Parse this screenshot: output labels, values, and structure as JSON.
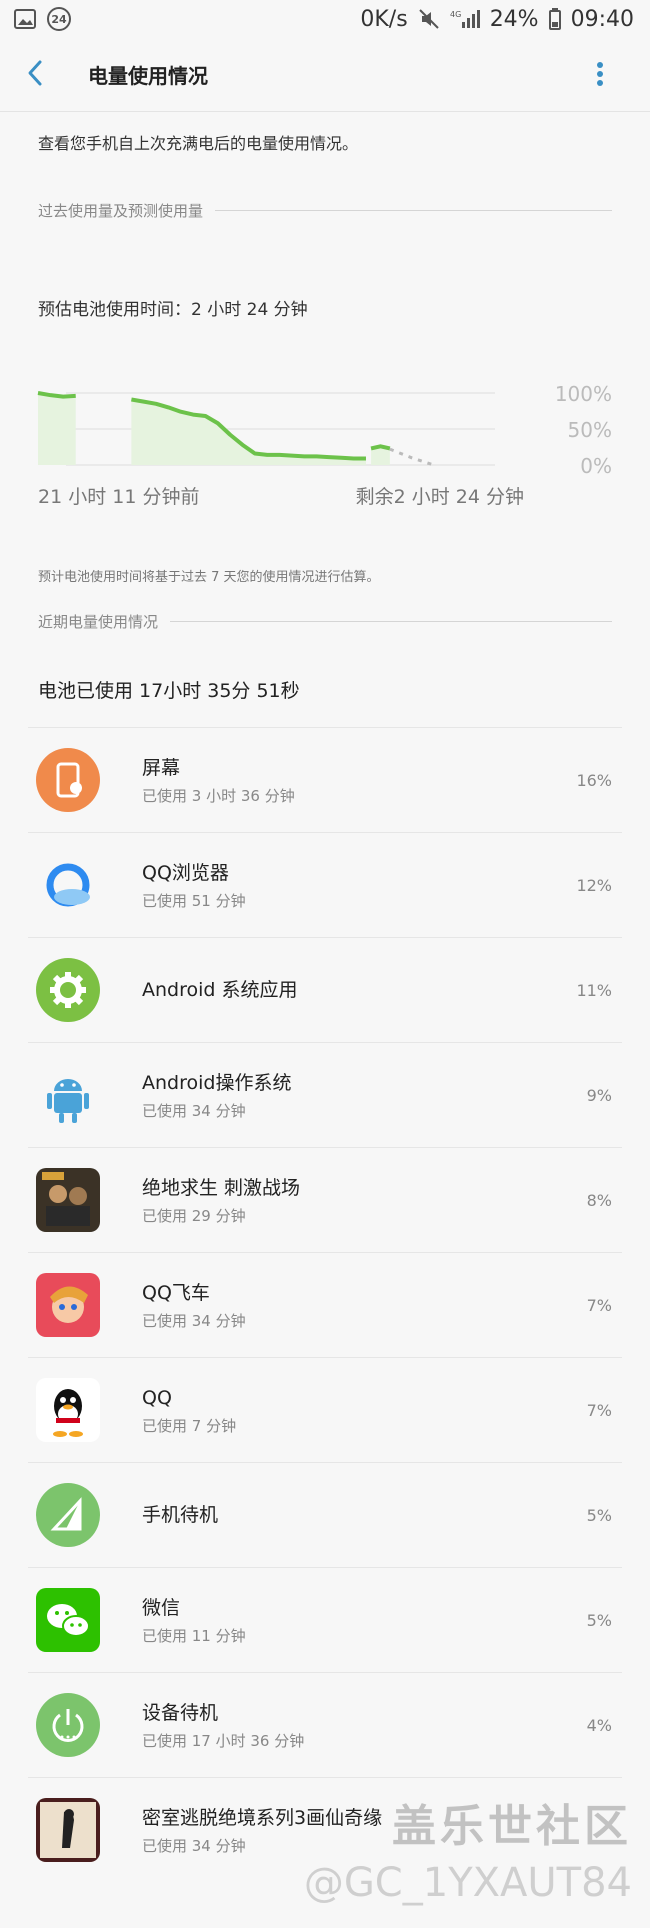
{
  "status_bar": {
    "badge": "24",
    "speed": "0K/s",
    "network": "4G",
    "battery": "24%",
    "time": "09:40"
  },
  "app_bar": {
    "title": "电量使用情况"
  },
  "description": "查看您手机自上次充满电后的电量使用情况。",
  "section_past": "过去使用量及预测使用量",
  "estimate_text": "预估电池使用时间：2 小时 24 分钟",
  "chart": {
    "y_labels": [
      "100%",
      "50%",
      "0%"
    ],
    "x_left": "21 小时 11 分钟前",
    "x_right": "剩余2 小时 24 分钟",
    "line_color": "#6cc24a",
    "fill_color": "#e6f3df"
  },
  "chart_data": {
    "type": "area",
    "title": "",
    "xlabel": "",
    "ylabel": "",
    "ylim": [
      0,
      100
    ],
    "x_start_label": "21 小时 11 分钟前",
    "x_end_label": "剩余2 小时 24 分钟",
    "series": [
      {
        "values": [
          100,
          97,
          95,
          96
        ]
      },
      {
        "values": [
          91,
          88,
          85,
          80,
          74,
          70,
          68,
          58,
          42,
          28,
          16,
          14,
          14,
          13,
          12,
          12,
          11,
          10,
          9,
          9
        ]
      },
      {
        "values": [
          23,
          26,
          23
        ]
      }
    ],
    "predicted": {
      "values": [
        22,
        10,
        0
      ]
    },
    "grid": true
  },
  "chart_note": "预计电池使用时间将基于过去 7 天您的使用情况进行估算。",
  "section_recent": "近期电量使用情况",
  "usage_total": "电池已使用 17小时 35分 51秒",
  "apps": [
    {
      "name": "屏幕",
      "sub": "已使用 3 小时 36 分钟",
      "pct": "16%",
      "icon": "screen-icon",
      "color": "#f08a4b"
    },
    {
      "name": "QQ浏览器",
      "sub": "已使用 51 分钟",
      "pct": "12%",
      "icon": "qq-browser-icon",
      "color": "#2e8bf0"
    },
    {
      "name": "Android 系统应用",
      "sub": "",
      "pct": "11%",
      "icon": "android-system-icon",
      "color": "#7cc043"
    },
    {
      "name": "Android操作系统",
      "sub": "已使用 34 分钟",
      "pct": "9%",
      "icon": "android-os-icon",
      "color": "#4aa3d8"
    },
    {
      "name": "绝地求生 刺激战场",
      "sub": "已使用 29 分钟",
      "pct": "8%",
      "icon": "pubg-icon",
      "color": "#5a4a3a"
    },
    {
      "name": "QQ飞车",
      "sub": "已使用 34 分钟",
      "pct": "7%",
      "icon": "qq-speed-icon",
      "color": "#e84b5a"
    },
    {
      "name": "QQ",
      "sub": "已使用 7 分钟",
      "pct": "7%",
      "icon": "qq-icon",
      "color": "#111111"
    },
    {
      "name": "手机待机",
      "sub": "",
      "pct": "5%",
      "icon": "phone-standby-icon",
      "color": "#7cc46c"
    },
    {
      "name": "微信",
      "sub": "已使用 11 分钟",
      "pct": "5%",
      "icon": "wechat-icon",
      "color": "#2dc100"
    },
    {
      "name": "设备待机",
      "sub": "已使用 17 小时 36 分钟",
      "pct": "4%",
      "icon": "device-standby-icon",
      "color": "#7cc46c"
    },
    {
      "name": "密室逃脱绝境系列3画仙奇缘",
      "sub": "已使用 34 分钟",
      "pct": "",
      "icon": "escape-game-icon",
      "color": "#7a2a2a"
    }
  ],
  "watermark": {
    "line1": "盖乐世社区",
    "line2": "@GC_1YXAUT84"
  }
}
